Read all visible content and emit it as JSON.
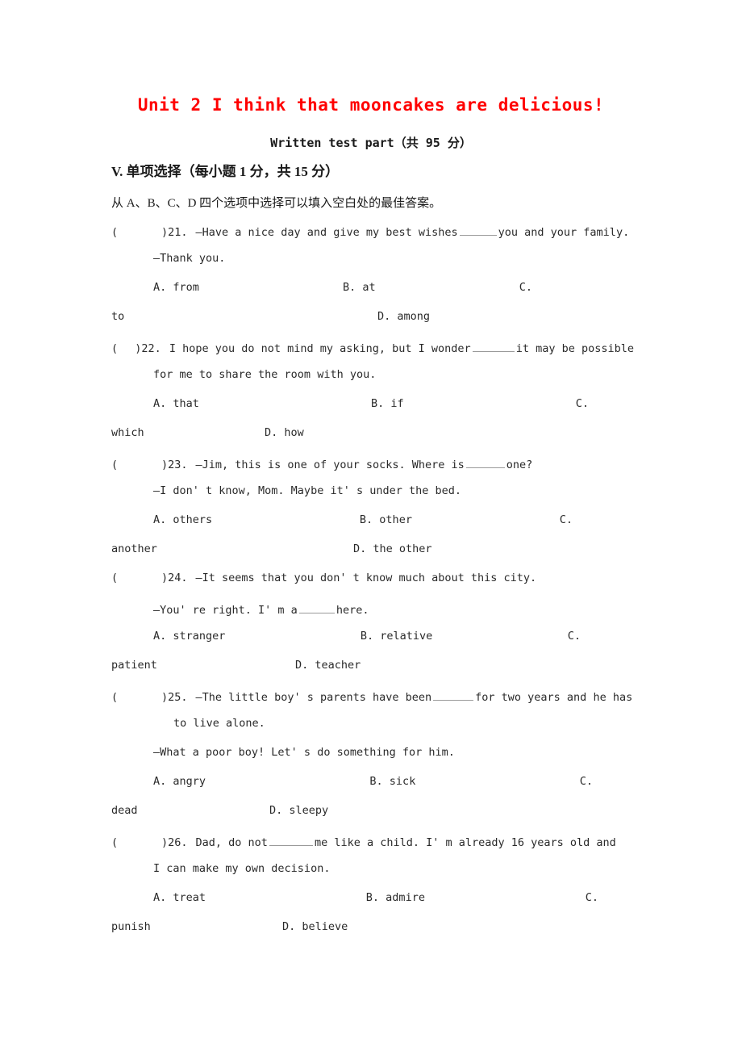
{
  "document": {
    "title": "Unit 2 I think that mooncakes are delicious!",
    "title_color": "#ff0000",
    "subtitle": "Written test part（共 95 分）",
    "section_heading": "V.  单项选择（每小题 1 分，共 15 分）",
    "instruction": "从 A、B、C、D 四个选项中选择可以填入空白处的最佳答案。"
  },
  "questions": [
    {
      "paren_open": "(",
      "paren_close": ")",
      "number": "21.",
      "stem_before": "—Have a nice day and give my best wishes",
      "stem_after": "you and your family.",
      "reply": "—Thank you.",
      "option_a": "A. from",
      "option_b": "B. at",
      "option_c_label": "C.",
      "option_c_text": "to",
      "option_d": "D. among"
    },
    {
      "paren_open": "(",
      "paren_close": ")",
      "number": "22.",
      "stem_before": "I hope you do not mind my asking, but I wonder",
      "stem_after": "it may be possible",
      "continuation": "for me to share the room with you.",
      "option_a": "A. that",
      "option_b": "B. if",
      "option_c_label": "C.",
      "option_c_text": "which",
      "option_d": "D. how"
    },
    {
      "paren_open": "(",
      "paren_close": ")",
      "number": "23.",
      "stem_before": "—Jim, this is one of your socks. Where is",
      "stem_after": "one?",
      "reply": "—I don' t know, Mom. Maybe it' s under the bed.",
      "option_a": "A. others",
      "option_b": "B. other",
      "option_c_label": "C.",
      "option_c_text": "another",
      "option_d": "D. the other"
    },
    {
      "paren_open": "(",
      "paren_close": ")",
      "number": "24.",
      "stem_full": "—It seems that you don' t know much about this city.",
      "reply_before": "—You' re right. I' m a",
      "reply_after": "here.",
      "option_a": "A. stranger",
      "option_b": "B. relative",
      "option_c_label": "C.",
      "option_c_text": "patient",
      "option_d": "D. teacher"
    },
    {
      "paren_open": "(",
      "paren_close": ")",
      "number": "25.",
      "stem_before": "—The little boy' s parents have been",
      "stem_after": "for two years and he has",
      "continuation": "to live alone.",
      "reply": "—What a poor boy! Let' s do something for him.",
      "option_a": "A. angry",
      "option_b": "B. sick",
      "option_c_label": "C.",
      "option_c_text": "dead",
      "option_d": "D. sleepy"
    },
    {
      "paren_open": "(",
      "paren_close": ")",
      "number": "26.",
      "stem_before": "Dad, do not",
      "stem_after": "me like a child. I' m already 16 years old and",
      "continuation": "I can make my own decision.",
      "option_a": "A. treat",
      "option_b": "B. admire",
      "option_c_label": "C.",
      "option_c_text": "punish",
      "option_d": "D. believe"
    }
  ]
}
